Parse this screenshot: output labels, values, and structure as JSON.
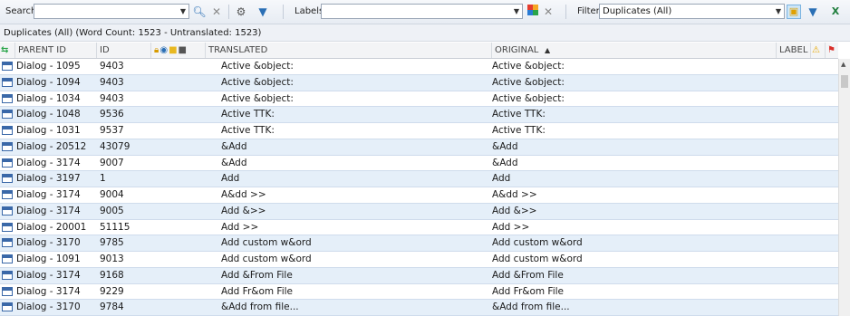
{
  "toolbar": {
    "search_label": "Search",
    "search_value": "",
    "labels_label": "Labels",
    "labels_value": "",
    "filter_label": "Filter",
    "filter_value": "Duplicates (All)"
  },
  "status": "Duplicates (All) (Word Count: 1523 - Untranslated: 1523)",
  "columns": {
    "parent_id": "PARENT ID",
    "id": "ID",
    "translated": "TRANSLATED",
    "original": "ORIGINAL",
    "label": "LABEL"
  },
  "rows": [
    {
      "parent": "Dialog - 1095",
      "id": "9403",
      "translated": "Active &object:",
      "original": "Active &object:"
    },
    {
      "parent": "Dialog - 1094",
      "id": "9403",
      "translated": "Active &object:",
      "original": "Active &object:"
    },
    {
      "parent": "Dialog - 1034",
      "id": "9403",
      "translated": "Active &object:",
      "original": "Active &object:"
    },
    {
      "parent": "Dialog - 1048",
      "id": "9536",
      "translated": "Active TTK:",
      "original": "Active TTK:"
    },
    {
      "parent": "Dialog - 1031",
      "id": "9537",
      "translated": "Active TTK:",
      "original": "Active TTK:"
    },
    {
      "parent": "Dialog - 20512",
      "id": "43079",
      "translated": "&Add",
      "original": "&Add"
    },
    {
      "parent": "Dialog - 3174",
      "id": "9007",
      "translated": "&Add",
      "original": "&Add"
    },
    {
      "parent": "Dialog - 3197",
      "id": "1",
      "translated": "Add",
      "original": "Add"
    },
    {
      "parent": "Dialog - 3174",
      "id": "9004",
      "translated": "A&dd >>",
      "original": "A&dd >>"
    },
    {
      "parent": "Dialog - 3174",
      "id": "9005",
      "translated": "Add &>>",
      "original": "Add &>>"
    },
    {
      "parent": "Dialog - 20001",
      "id": "51115",
      "translated": "Add >>",
      "original": "Add >>"
    },
    {
      "parent": "Dialog - 3170",
      "id": "9785",
      "translated": "Add custom w&ord",
      "original": "Add custom w&ord"
    },
    {
      "parent": "Dialog - 1091",
      "id": "9013",
      "translated": "Add custom w&ord",
      "original": "Add custom w&ord"
    },
    {
      "parent": "Dialog - 3174",
      "id": "9168",
      "translated": "Add &From File",
      "original": "Add &From File"
    },
    {
      "parent": "Dialog - 3174",
      "id": "9229",
      "translated": "Add Fr&om File",
      "original": "Add Fr&om File"
    },
    {
      "parent": "Dialog - 3170",
      "id": "9784",
      "translated": "&Add from file...",
      "original": "&Add from file..."
    }
  ],
  "icons": {
    "search": "magnifier-icon",
    "clear": "x-icon",
    "settings": "gear-icon",
    "filter": "funnel-icon",
    "colors": "color-grid-icon",
    "warning": "warning-icon",
    "flag": "flag-icon",
    "excel": "excel-icon"
  },
  "colors": {
    "row_alt": "#e5eff9",
    "row_selected": "#cfe4f7",
    "accent": "#2a6fb5"
  }
}
